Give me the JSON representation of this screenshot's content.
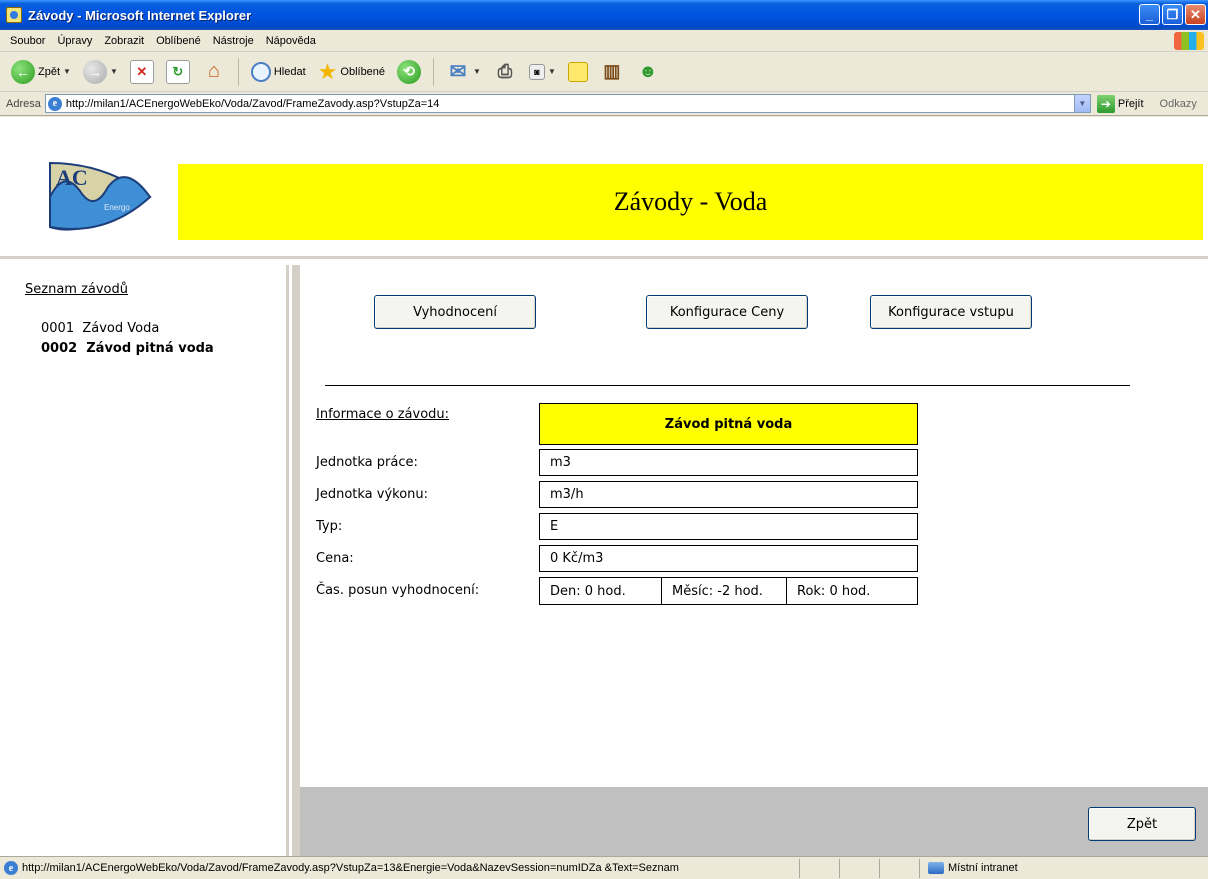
{
  "window": {
    "title": "Závody - Microsoft Internet Explorer",
    "controls": [
      "_",
      "❐",
      "✕"
    ]
  },
  "menu": {
    "items": [
      "Soubor",
      "Úpravy",
      "Zobrazit",
      "Oblíbené",
      "Nástroje",
      "Nápověda"
    ]
  },
  "toolbar": {
    "back_label": "Zpět",
    "search_label": "Hledat",
    "favorites_label": "Oblíbené"
  },
  "address": {
    "label": "Adresa",
    "url": "http://milan1/ACEnergoWebEko/Voda/Zavod/FrameZavody.asp?VstupZa=14",
    "go_label": "Přejít",
    "links_label": "Odkazy"
  },
  "header": {
    "logo_text": "AC",
    "logo_sub": "Energo",
    "banner_title": "Závody - Voda"
  },
  "sidebar": {
    "title": "Seznam závodů",
    "items": [
      {
        "code": "0001",
        "name": "Závod Voda",
        "selected": false
      },
      {
        "code": "0002",
        "name": "Závod pitná voda",
        "selected": true
      }
    ]
  },
  "actions": {
    "evaluation": "Vyhodnocení",
    "price_config": "Konfigurace Ceny",
    "input_config": "Konfigurace vstupu"
  },
  "info": {
    "heading": "Informace o závodu:",
    "plant_name": "Závod pitná voda",
    "rows": [
      {
        "label": "Jednotka práce:",
        "value": "m3"
      },
      {
        "label": "Jednotka výkonu:",
        "value": "m3/h"
      },
      {
        "label": "Typ:",
        "value": "E"
      },
      {
        "label": "Cena:",
        "value": "0 Kč/m3"
      }
    ],
    "shift_label": "Čas. posun vyhodnocení:",
    "shift": {
      "day": "Den: 0 hod.",
      "month": "Měsíc: -2 hod.",
      "year": "Rok: 0 hod."
    }
  },
  "footer": {
    "back_label": "Zpět"
  },
  "status": {
    "url": "http://milan1/ACEnergoWebEko/Voda/Zavod/FrameZavody.asp?VstupZa=13&Energie=Voda&NazevSession=numIDZa &Text=Seznam",
    "zone": "Místní intranet"
  },
  "colors": {
    "banner": "#ffff00",
    "frame_border": "#d4d0c8",
    "footer_bar": "#c0c0c0"
  }
}
